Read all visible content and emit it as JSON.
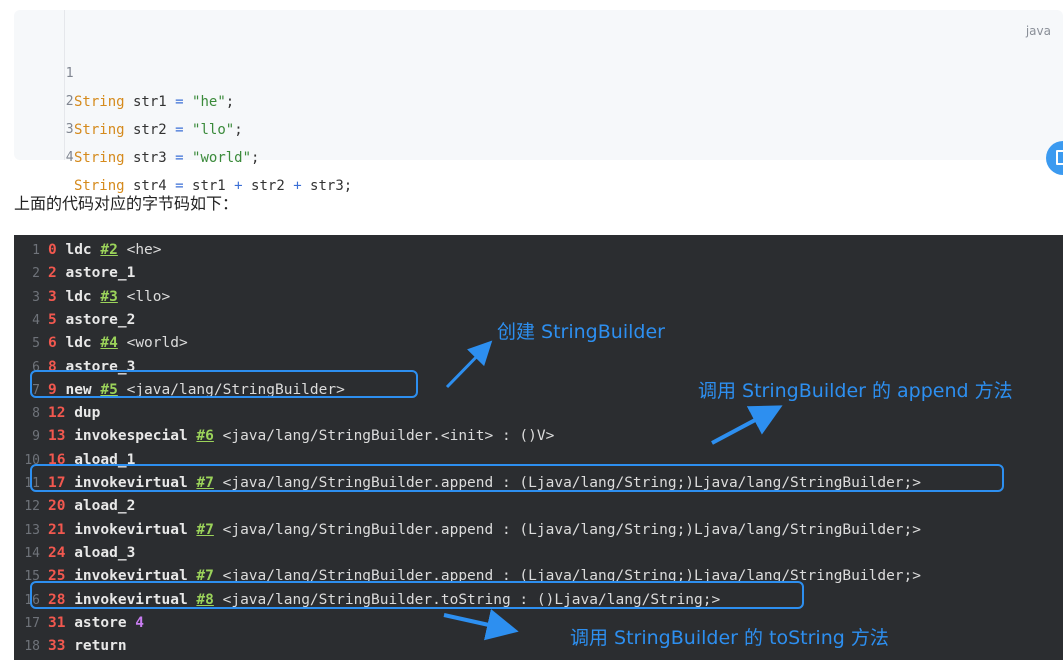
{
  "code_block": {
    "language": "java",
    "lines": [
      {
        "num": "1",
        "type": "String",
        "rest": " str1 ",
        "eq": "=",
        "val": "\"he\"",
        "end": ";"
      },
      {
        "num": "2",
        "type": "String",
        "rest": " str2 ",
        "eq": "=",
        "val": "\"llo\"",
        "end": ";"
      },
      {
        "num": "3",
        "type": "String",
        "rest": " str3 ",
        "eq": "=",
        "val": "\"world\"",
        "end": ";"
      },
      {
        "num": "4",
        "type": "String",
        "rest": " str4 ",
        "eq": "=",
        "val": " str1 + str2 + str3",
        "end": ";"
      }
    ]
  },
  "caption": "上面的代码对应的字节码如下：",
  "bytecode": [
    {
      "ln": "1",
      "off": "0",
      "op": "ldc",
      "ref": "#2",
      "arg": "<he>"
    },
    {
      "ln": "2",
      "off": "2",
      "op": "astore_1",
      "ref": "",
      "arg": ""
    },
    {
      "ln": "3",
      "off": "3",
      "op": "ldc",
      "ref": "#3",
      "arg": "<llo>"
    },
    {
      "ln": "4",
      "off": "5",
      "op": "astore_2",
      "ref": "",
      "arg": ""
    },
    {
      "ln": "5",
      "off": "6",
      "op": "ldc",
      "ref": "#4",
      "arg": "<world>"
    },
    {
      "ln": "6",
      "off": "8",
      "op": "astore_3",
      "ref": "",
      "arg": ""
    },
    {
      "ln": "7",
      "off": "9",
      "op": "new",
      "ref": "#5",
      "arg": "<java/lang/StringBuilder>"
    },
    {
      "ln": "8",
      "off": "12",
      "op": "dup",
      "ref": "",
      "arg": ""
    },
    {
      "ln": "9",
      "off": "13",
      "op": "invokespecial",
      "ref": "#6",
      "arg": "<java/lang/StringBuilder.<init> : ()V>"
    },
    {
      "ln": "10",
      "off": "16",
      "op": "aload_1",
      "ref": "",
      "arg": ""
    },
    {
      "ln": "11",
      "off": "17",
      "op": "invokevirtual",
      "ref": "#7",
      "arg": "<java/lang/StringBuilder.append : (Ljava/lang/String;)Ljava/lang/StringBuilder;>"
    },
    {
      "ln": "12",
      "off": "20",
      "op": "aload_2",
      "ref": "",
      "arg": ""
    },
    {
      "ln": "13",
      "off": "21",
      "op": "invokevirtual",
      "ref": "#7",
      "arg": "<java/lang/StringBuilder.append : (Ljava/lang/String;)Ljava/lang/StringBuilder;>"
    },
    {
      "ln": "14",
      "off": "24",
      "op": "aload_3",
      "ref": "",
      "arg": ""
    },
    {
      "ln": "15",
      "off": "25",
      "op": "invokevirtual",
      "ref": "#7",
      "arg": "<java/lang/StringBuilder.append : (Ljava/lang/String;)Ljava/lang/StringBuilder;>"
    },
    {
      "ln": "16",
      "off": "28",
      "op": "invokevirtual",
      "ref": "#8",
      "arg": "<java/lang/StringBuilder.toString : ()Ljava/lang/String;>"
    },
    {
      "ln": "17",
      "off": "31",
      "op": "astore",
      "ref": "",
      "arg": "",
      "num": "4"
    },
    {
      "ln": "18",
      "off": "33",
      "op": "return",
      "ref": "",
      "arg": ""
    }
  ],
  "annotations": {
    "create": "创建 StringBuilder",
    "append": "调用 StringBuilder 的 append 方法",
    "tostring": "调用 StringBuilder 的 toString 方法"
  },
  "colors": {
    "accent": "#2d8ff0",
    "offset": "#f2584f",
    "ref": "#9bd35a",
    "keyword": "#d58a1c",
    "string": "#3a8a3a"
  },
  "icons": {
    "copy": "copy-icon"
  }
}
